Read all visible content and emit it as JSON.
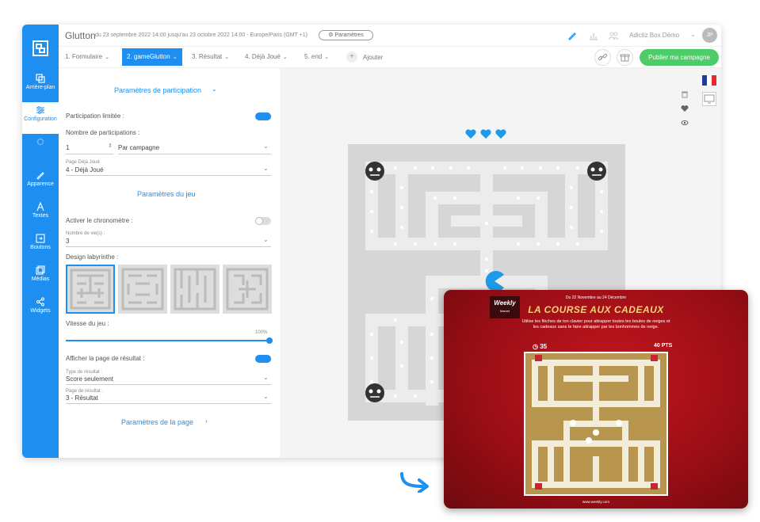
{
  "header": {
    "app_title": "Glutton",
    "dates": "du 23 septembre 2022 14:00 jusqu'au 23 octobre 2022 14:00 - Europe/Paris (GMT +1)",
    "params_button": "Paramètres",
    "account": "Adictiz Box Démo",
    "avatar": "JP"
  },
  "tabs": [
    {
      "label": "1. Formulaire"
    },
    {
      "label": "2. gameGlutton"
    },
    {
      "label": "3. Résultat"
    },
    {
      "label": "4. Déjà Joué"
    },
    {
      "label": "5. end"
    }
  ],
  "tabs_add": "Ajouter",
  "publish": "Publier ma campagne",
  "sidebar": {
    "items": [
      {
        "label": "Arrière-plan"
      },
      {
        "label": "Configuration"
      },
      {
        "label": "Apparence"
      },
      {
        "label": "Textes"
      },
      {
        "label": "Boutons"
      },
      {
        "label": "Médias"
      },
      {
        "label": "Widgets"
      }
    ]
  },
  "panel": {
    "section_participation": "Paramètres de participation",
    "limited_label": "Participation limitée :",
    "limited_on": true,
    "count_label": "Nombre de participations :",
    "count_value": "1",
    "count_mode": "Par campagne",
    "page_played_label": "Page Déjà Joué",
    "page_played_value": "4 - Déjà Joué",
    "section_game": "Paramètres du jeu",
    "timer_label": "Activer le chronomètre :",
    "timer_on": false,
    "lives_label": "Nombre de vie(s) :",
    "lives_value": "3",
    "maze_label": "Design labyrinthe :",
    "speed_label": "Vitesse du jeu :",
    "speed_value": "100%",
    "speed_fraction": 1.0,
    "result_label": "Afficher la page de résultat :",
    "result_on": true,
    "result_type_label": "Type de résultat :",
    "result_type_value": "Score seulement",
    "result_page_label": "Page de résultat :",
    "result_page_value": "3 - Résultat",
    "section_page": "Paramètres de la page"
  },
  "promo": {
    "logo": "Weekly",
    "logo_sub": "Market",
    "date": "Du 22 Novembre au 24 Décembre",
    "title": "LA COURSE AUX CADEAUX",
    "subtitle": "Utilise les flèches de ton clavier pour attrapper toutes les boules de neiges et les cadeaux sans te faire attrapper par les bonhommes de neige.",
    "timer": "35",
    "points": "40 PTS",
    "url": "www.weekly.com"
  },
  "colors": {
    "accent": "#1e8ff0",
    "publish": "#4ccd67",
    "promo_red": "#b3121a",
    "promo_gold": "#f3d27a"
  }
}
